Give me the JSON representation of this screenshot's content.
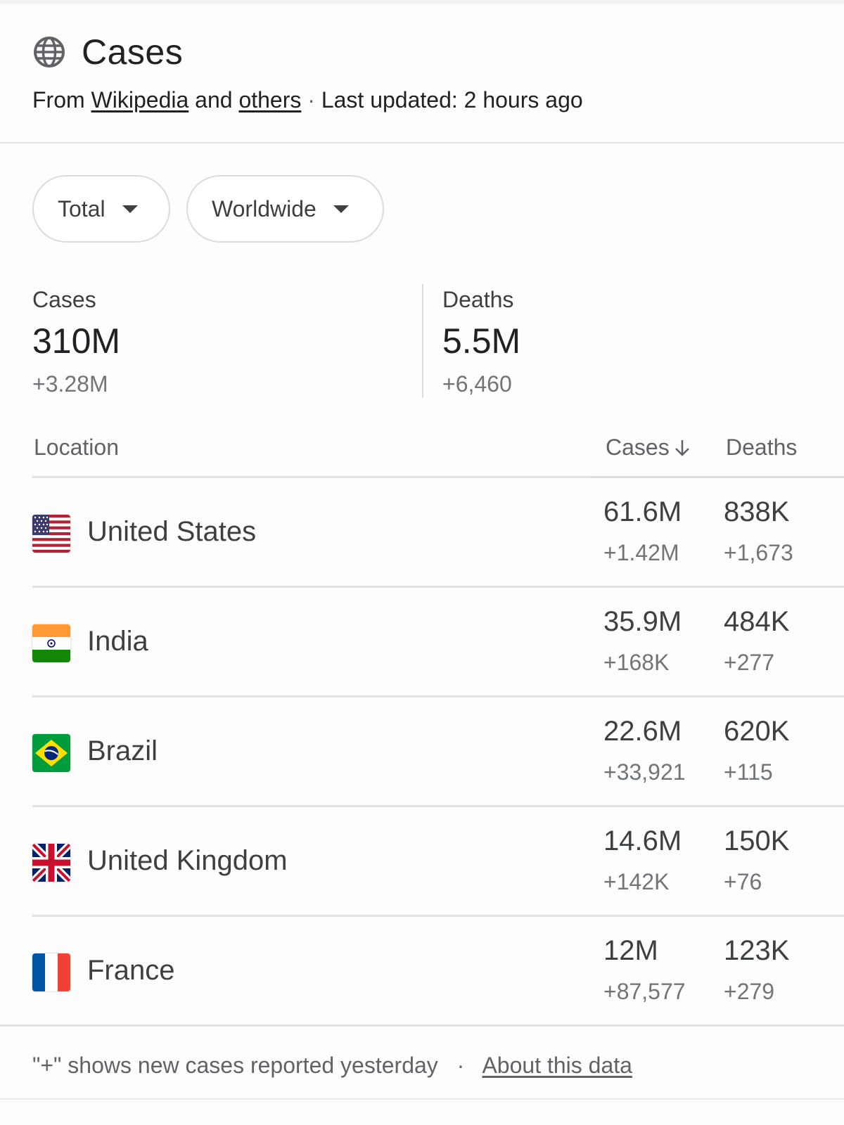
{
  "header": {
    "title": "Cases",
    "icon": "globe-icon",
    "source_prefix": "From",
    "source_link_1": "Wikipedia",
    "source_and": "and",
    "source_link_2": "others",
    "separator": "·",
    "last_updated": "Last updated: 2 hours ago"
  },
  "filters": {
    "type_label": "Total",
    "region_label": "Worldwide"
  },
  "summary": {
    "cases_label": "Cases",
    "cases_value": "310M",
    "cases_delta": "+3.28M",
    "deaths_label": "Deaths",
    "deaths_value": "5.5M",
    "deaths_delta": "+6,460"
  },
  "table": {
    "col_location": "Location",
    "col_cases": "Cases",
    "col_deaths": "Deaths",
    "rows": [
      {
        "country": "United States",
        "flag": "us-flag-icon",
        "cases": "61.6M",
        "cases_delta": "+1.42M",
        "deaths": "838K",
        "deaths_delta": "+1,673"
      },
      {
        "country": "India",
        "flag": "india-flag-icon",
        "cases": "35.9M",
        "cases_delta": "+168K",
        "deaths": "484K",
        "deaths_delta": "+277"
      },
      {
        "country": "Brazil",
        "flag": "brazil-flag-icon",
        "cases": "22.6M",
        "cases_delta": "+33,921",
        "deaths": "620K",
        "deaths_delta": "+115"
      },
      {
        "country": "United Kingdom",
        "flag": "uk-flag-icon",
        "cases": "14.6M",
        "cases_delta": "+142K",
        "deaths": "150K",
        "deaths_delta": "+76"
      },
      {
        "country": "France",
        "flag": "france-flag-icon",
        "cases": "12M",
        "cases_delta": "+87,577",
        "deaths": "123K",
        "deaths_delta": "+279"
      }
    ]
  },
  "footer": {
    "note": "\"+\" shows new cases reported yesterday",
    "separator": "·",
    "about_link": "About this data"
  }
}
